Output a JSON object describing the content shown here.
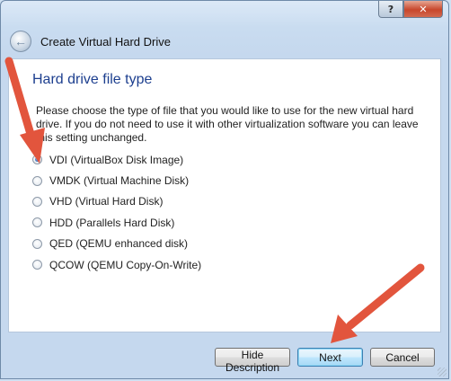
{
  "window": {
    "help_label": "?",
    "close_label": "✕",
    "back_icon": "back-arrow-icon",
    "title": "Create Virtual Hard Drive"
  },
  "page": {
    "heading": "Hard drive file type",
    "description": "Please choose the type of file that you would like to use for the new virtual hard drive. If you do not need to use it with other virtualization software you can leave this setting unchanged."
  },
  "options": [
    {
      "label": "VDI (VirtualBox Disk Image)",
      "checked": true
    },
    {
      "label": "VMDK (Virtual Machine Disk)",
      "checked": false
    },
    {
      "label": "VHD (Virtual Hard Disk)",
      "checked": false
    },
    {
      "label": "HDD (Parallels Hard Disk)",
      "checked": false
    },
    {
      "label": "QED (QEMU enhanced disk)",
      "checked": false
    },
    {
      "label": "QCOW (QEMU Copy-On-Write)",
      "checked": false
    }
  ],
  "buttons": {
    "hide_description": "Hide Description",
    "next": "Next",
    "cancel": "Cancel"
  },
  "annotation": {
    "arrow_color": "#e2553d"
  }
}
